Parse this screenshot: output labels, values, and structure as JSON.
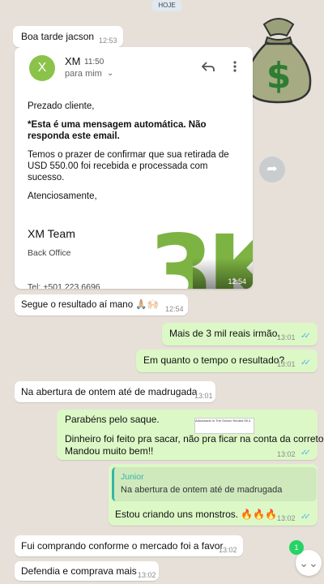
{
  "date_chip": "HOJE",
  "messages": {
    "m1": {
      "text": "Boa tarde jacson",
      "time": "12:53"
    },
    "m2": {
      "text": "Segue o resultado aí mano 🙏🏼🙌🏻",
      "time": "12:54"
    },
    "m3": {
      "text": "Mais de 3 mil reais irmão.",
      "time": "13:01"
    },
    "m4": {
      "text": "Em quanto o tempo o resultado?",
      "time": "13:01"
    },
    "m5": {
      "text": "Na abertura de ontem até  de madrugada",
      "time": "13:01"
    },
    "m6": {
      "line1": "Parabéns pelo saque.",
      "line2": "Dinheiro foi feito pra sacar, não pra ficar na conta da corretora.",
      "line3": "Mandou muito bem!!",
      "time": "13:02",
      "thumb_text": "Adicionado in The Ocean Yieoted 95.4"
    },
    "m7": {
      "quote_author": "Junior",
      "quote_text": "Na abertura de ontem até  de madrugada",
      "text": "Estou criando uns monstros. 🔥🔥🔥",
      "time": "13:02"
    },
    "m8": {
      "text": "Fui comprando conforme o mercado foi a favor",
      "time": "13:02"
    },
    "m9": {
      "text": "Defendia e comprava mais",
      "time": "13:02"
    }
  },
  "email": {
    "avatar_letter": "X",
    "sender": "XM",
    "sent_time": "11:50",
    "recipient": "para mim",
    "greeting": "Prezado cliente,",
    "auto_notice": "*Esta é uma mensagem automática. Não responda este email.",
    "body": "Temos o prazer de confirmar que sua retirada de USD 550.00 foi recebida e processada com sucesso.",
    "closing": "Atenciosamente,",
    "team": "XM Team",
    "dept": "Back Office",
    "phone_partial": "Tel: +501 223 6696",
    "overlay_text": "3K",
    "image_time": "12:54"
  },
  "unread_count": "1",
  "colors": {
    "wallpaper": "#e7e0d8",
    "incoming": "#ffffff",
    "outgoing": "#dcf8c6",
    "accent_green": "#7cb342",
    "read_ticks": "#4fb6ec"
  },
  "icons": [
    "reply-icon",
    "more-vert-icon",
    "chevron-down-icon",
    "forward-icon",
    "money-bag-icon",
    "scroll-down-icon",
    "read-ticks-icon"
  ]
}
